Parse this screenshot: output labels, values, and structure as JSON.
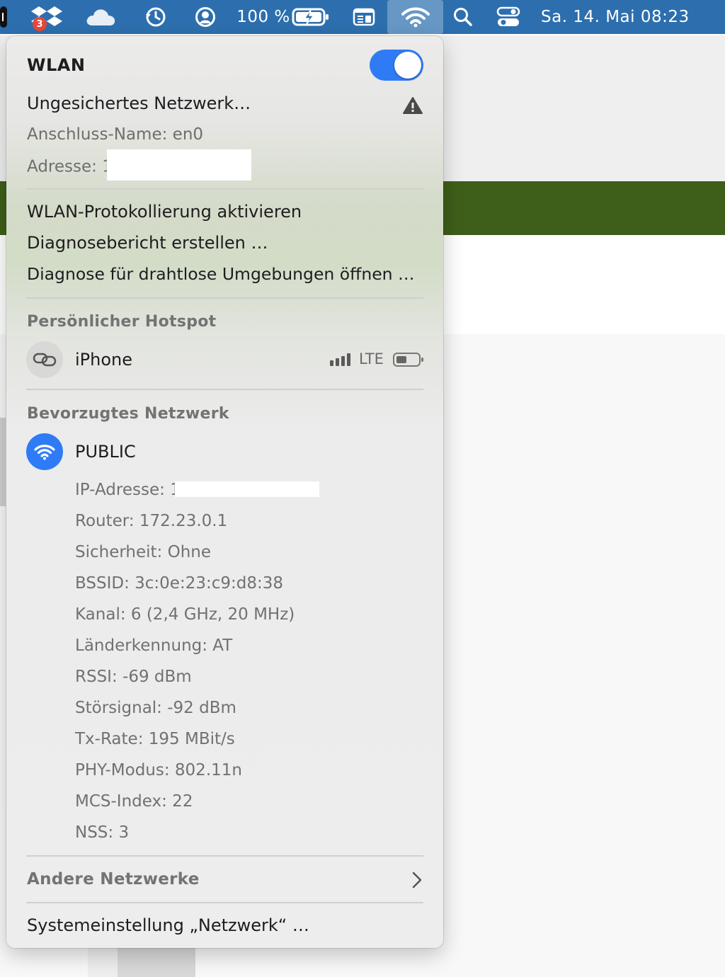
{
  "menubar": {
    "dropbox_badge": "3",
    "battery_percent": "100 %",
    "datetime": "Sa. 14. Mai  08:23"
  },
  "wifi_menu": {
    "title": "WLAN",
    "toggle_on": true,
    "warning_network": "Ungesichertes Netzwerk…",
    "interface_name": "Anschluss-Name: en0",
    "address_label": "Adresse:",
    "address_prefix": "1",
    "actions": [
      "WLAN-Protokollierung aktivieren",
      "Diagnosebericht erstellen …",
      "Diagnose für drahtlose Umgebungen öffnen …"
    ],
    "hotspot_header": "Persönlicher Hotspot",
    "hotspot": {
      "name": "iPhone",
      "network_type": "LTE"
    },
    "preferred_header": "Bevorzugtes Netzwerk",
    "preferred": {
      "name": "PUBLIC",
      "ip_label": "IP-Adresse:",
      "ip_prefix": "1",
      "details": [
        "Router: 172.23.0.1",
        "Sicherheit: Ohne",
        "BSSID: 3c:0e:23:c9:d8:38",
        "Kanal: 6 (2,4 GHz, 20 MHz)",
        "Länderkennung: AT",
        "RSSI: -69 dBm",
        "Störsignal: -92 dBm",
        "Tx-Rate: 195 MBit/s",
        "PHY-Modus: 802.11n",
        "MCS-Index: 22",
        "NSS: 3"
      ]
    },
    "other_networks": "Andere Netzwerke",
    "settings_link": "Systemeinstellung „Netzwerk“ …"
  },
  "colors": {
    "menubar": "#2d6fae",
    "accent": "#2f7bf5",
    "badge": "#e9463b"
  }
}
